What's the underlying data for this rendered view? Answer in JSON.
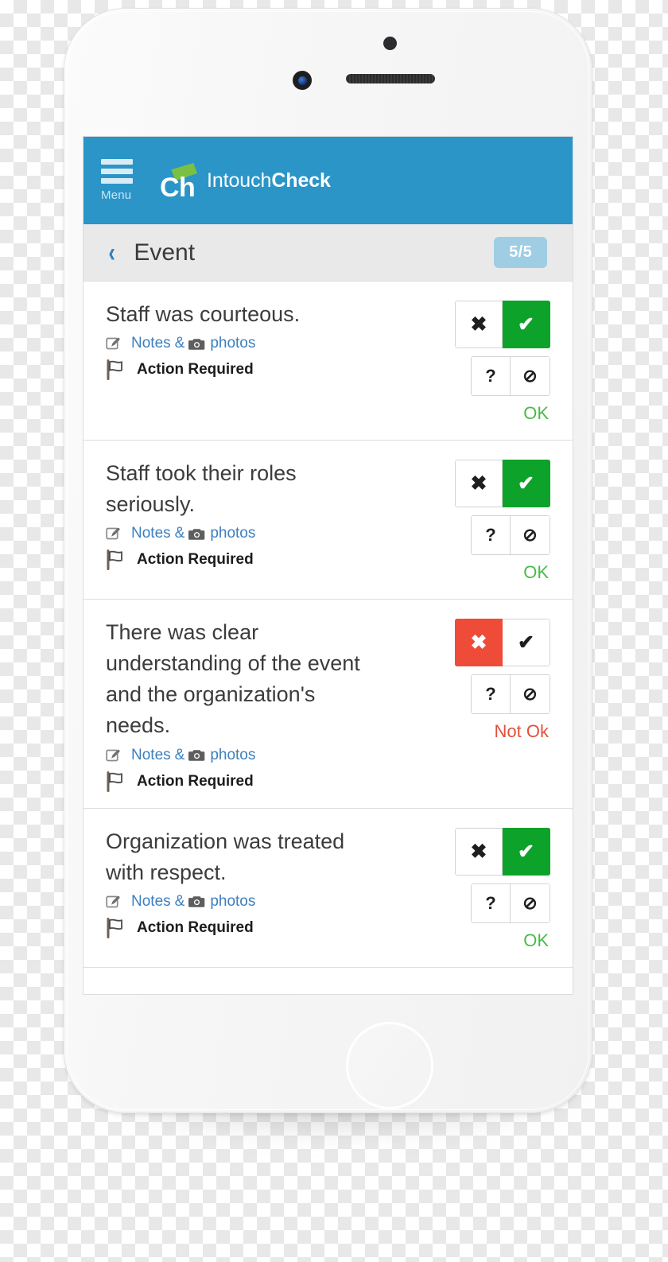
{
  "app": {
    "brand_prefix": "Intouch",
    "brand_suffix": "Check",
    "logo_text": "Ch",
    "menu_label": "Menu",
    "header_color": "#2b95c8",
    "accent_green": "#0da32a",
    "accent_red": "#ee4b39",
    "badge_color": "#9ecde4",
    "link_color": "#3c7fc0"
  },
  "sub_header": {
    "back_glyph": "‹",
    "title": "Event",
    "count_badge": "5/5"
  },
  "labels": {
    "notes": "Notes",
    "amp": "&",
    "photos": "photos",
    "action_required": "Action Required",
    "cross_glyph": "✖",
    "check_glyph": "✔",
    "question_glyph": "?",
    "na_glyph": "⊘"
  },
  "items": [
    {
      "text": "Staff was courteous.",
      "answer": "ok",
      "status": "OK"
    },
    {
      "text": "Staff took their roles seriously.",
      "answer": "ok",
      "status": "OK"
    },
    {
      "text": "There was clear understanding of the event and the organization's needs.",
      "answer": "not_ok",
      "status": "Not Ok"
    },
    {
      "text": "Organization was treated with respect.",
      "answer": "ok",
      "status": "OK"
    }
  ]
}
